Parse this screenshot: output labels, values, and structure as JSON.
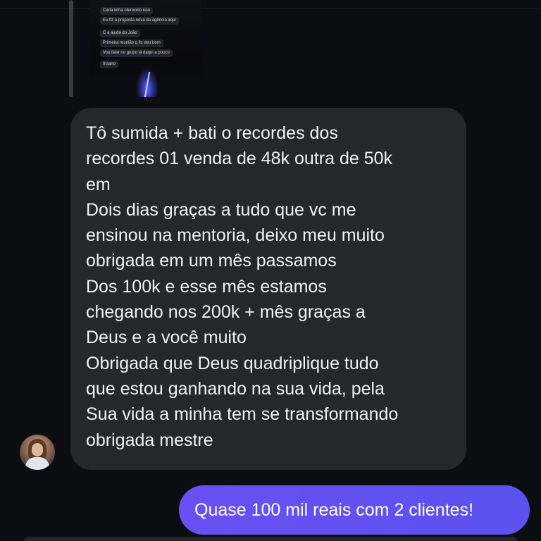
{
  "quoted_story": {
    "messages": [
      {
        "text": "Cada linha oferecido isso",
        "time": ""
      },
      {
        "text": "Eu fiz a proposta nova da agência aqui",
        "time": ""
      },
      {
        "text": "C a ajuda do João",
        "time": ""
      },
      {
        "text": "Primeira reunião q fiz deu bom",
        "time": ""
      },
      {
        "text": "Vou falar no grupo lá daqui a pouco",
        "time": ""
      },
      {
        "text": "Insano",
        "time": ""
      }
    ]
  },
  "incoming_message": {
    "lines": [
      "Tô sumida + bati o recordes dos",
      "recordes 01 venda de 48k outra de 50k",
      "em",
      "Dois dias graças a tudo que vc me",
      "ensinou na mentoria, deixo meu muito",
      "obrigada em um mês passamos",
      "Dos 100k e esse mês estamos",
      "chegando nos 200k + mês graças a",
      "Deus e a você muito",
      "Obrigada que Deus quadriplique tudo",
      "que estou ganhando na sua vida, pela",
      "Sua vida a minha tem se transformando",
      "obrigada mestre"
    ]
  },
  "outgoing_message": {
    "text": "Quase 100 mil reais com 2 clientes!"
  },
  "colors": {
    "background": "#0c0d12",
    "incoming_bubble": "#26272d",
    "outgoing_bubble": "#6a4ff2"
  }
}
